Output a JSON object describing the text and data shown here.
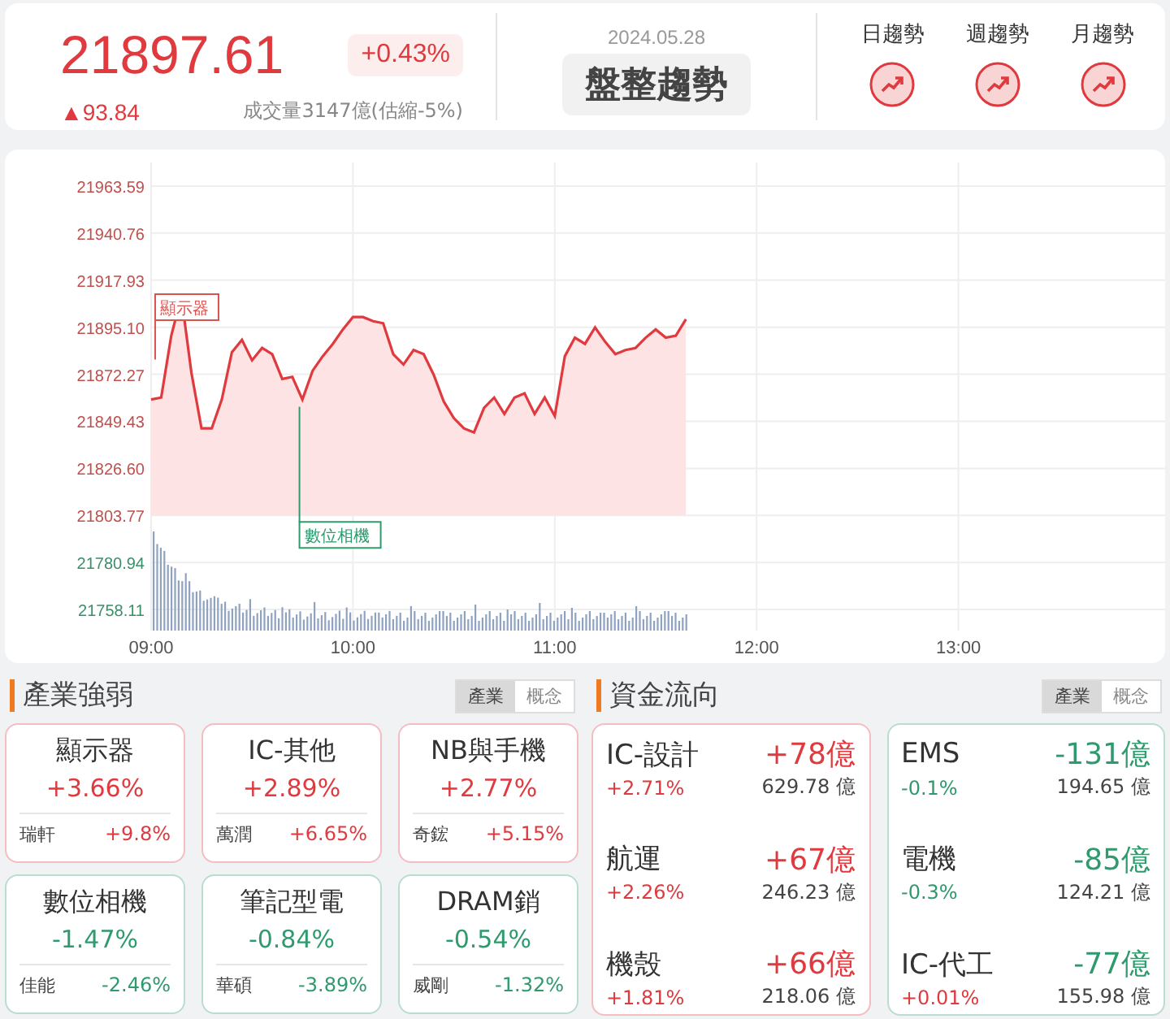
{
  "quote": {
    "price": "21897.61",
    "change_pct": "+0.43%",
    "change": "▲93.84",
    "volume": "成交量3147億(估縮-5%)",
    "color": "#e0393e"
  },
  "trend": {
    "date": "2024.05.28",
    "label": "盤整趨勢"
  },
  "trend_indicators": [
    {
      "label": "日趨勢"
    },
    {
      "label": "週趨勢"
    },
    {
      "label": "月趨勢"
    }
  ],
  "chart": {
    "chart_data": {
      "type": "area",
      "categories": [
        "09:00",
        null,
        null,
        null,
        null,
        null,
        null,
        null,
        null,
        null,
        null,
        null,
        null,
        null,
        null,
        null,
        null,
        null,
        null,
        null,
        "10:00",
        null,
        null,
        null,
        null,
        null,
        null,
        null,
        null,
        null,
        null,
        null,
        null,
        null,
        null,
        null,
        null,
        null,
        null,
        null,
        "11:00",
        null,
        null,
        null,
        null,
        null,
        null,
        null,
        null,
        null,
        null,
        null,
        null,
        null,
        null,
        null,
        null,
        null,
        null,
        null,
        "12:00",
        null,
        null,
        null,
        null,
        null,
        null,
        null,
        null,
        null,
        null,
        null,
        null,
        null,
        null,
        null,
        null,
        null,
        null,
        null,
        "13:00",
        null,
        null,
        null,
        null,
        null,
        null,
        null,
        null,
        null,
        null,
        null,
        null,
        null,
        null,
        null,
        null,
        null,
        null,
        null,
        null
      ],
      "series": [
        {
          "color": "#e0393e",
          "values": [
            21860,
            21861,
            21891,
            21910,
            21873,
            21846,
            21846,
            21860,
            21883,
            21889,
            21879,
            21885,
            21882,
            21870,
            21871,
            21860,
            21874,
            21881,
            21887,
            21894,
            21900,
            21900,
            21898,
            21897,
            21882,
            21877,
            21884,
            21882,
            21872,
            21859,
            21851,
            21846,
            21844,
            21856,
            21861,
            21853,
            21861,
            21863,
            21853,
            21861,
            21852,
            21881,
            21890,
            21887,
            21895,
            21888,
            21882,
            21884,
            21885,
            21890,
            21894,
            21890,
            21891,
            21899,
            null,
            null,
            null,
            null,
            null,
            null,
            null,
            null,
            null,
            null,
            null,
            null,
            null,
            null,
            null,
            null,
            null,
            null,
            null,
            null,
            null,
            null,
            null,
            null,
            null,
            null,
            null,
            null,
            null,
            null,
            null,
            null,
            null,
            null,
            null,
            null,
            null,
            null,
            null,
            null,
            null,
            null,
            null,
            null,
            null,
            null,
            null
          ]
        }
      ],
      "grid": true,
      "ylim": [
        21747.9,
        21975
      ],
      "yticks": [
        {
          "value": 21963.59,
          "label": "21963.59"
        },
        {
          "value": 21940.76,
          "label": "21940.76"
        },
        {
          "value": 21917.93,
          "label": "21917.93"
        },
        {
          "value": 21895.1,
          "label": "21895.10"
        },
        {
          "value": 21872.27,
          "label": "21872.27"
        },
        {
          "value": 21849.43,
          "label": "21849.43"
        },
        {
          "value": 21826.6,
          "label": "21826.60"
        },
        {
          "value": 21803.77,
          "label": "21803.77"
        },
        {
          "value": 21780.94,
          "label": "21780.94"
        },
        {
          "value": 21758.11,
          "label": "21758.11"
        }
      ],
      "annotations": [
        "顯示器",
        "數位相機"
      ]
    }
  },
  "industry_strength": {
    "title": "產業強弱",
    "tabs": [
      {
        "label": "產業",
        "selected": true
      },
      {
        "label": "概念",
        "selected": false
      }
    ],
    "cards": [
      {
        "name": "顯示器",
        "change": "+3.66%",
        "stock": "瑞軒",
        "stock_change": "+9.8%",
        "color": "#e0393e"
      },
      {
        "name": "IC-其他",
        "change": "+2.89%",
        "stock": "萬潤",
        "stock_change": "+6.65%",
        "color": "#e0393e"
      },
      {
        "name": "NB與手機",
        "change": "+2.77%",
        "stock": "奇鋐",
        "stock_change": "+5.15%",
        "color": "#e0393e"
      },
      {
        "name": "數位相機",
        "change": "-1.47%",
        "stock": "佳能",
        "stock_change": "-2.46%",
        "color": "#2e9a6e"
      },
      {
        "name": "筆記型電",
        "change": "-0.84%",
        "stock": "華碩",
        "stock_change": "-3.89%",
        "color": "#2e9a6e"
      },
      {
        "name": "DRAM銷",
        "change": "-0.54%",
        "stock": "威剛",
        "stock_change": "-1.32%",
        "color": "#2e9a6e"
      }
    ]
  },
  "fund_flow": {
    "title": "資金流向",
    "tabs": [
      {
        "label": "產業",
        "selected": true
      },
      {
        "label": "概念",
        "selected": false
      }
    ],
    "groups": [
      {
        "color": "#e0393e",
        "items": [
          {
            "name": "IC-設計",
            "flow": "+78億",
            "change": "+2.71%",
            "color": "#e0393e",
            "amount": "629.78 億"
          },
          {
            "name": "航運",
            "flow": "+67億",
            "change": "+2.26%",
            "color": "#e0393e",
            "amount": "246.23 億"
          },
          {
            "name": "機殼",
            "flow": "+66億",
            "change": "+1.81%",
            "color": "#e0393e",
            "amount": "218.06 億"
          }
        ]
      },
      {
        "color": "#2e9a6e",
        "items": [
          {
            "name": "EMS",
            "flow": "-131億",
            "change": "-0.1%",
            "color": "#2e9a6e",
            "amount": "194.65 億"
          },
          {
            "name": "電機",
            "flow": "-85億",
            "change": "-0.3%",
            "color": "#2e9a6e",
            "amount": "124.21 億"
          },
          {
            "name": "IC-代工",
            "flow": "-77億",
            "change": "+0.01%",
            "color": "#e0393e",
            "amount": "155.98 億"
          }
        ]
      }
    ]
  }
}
